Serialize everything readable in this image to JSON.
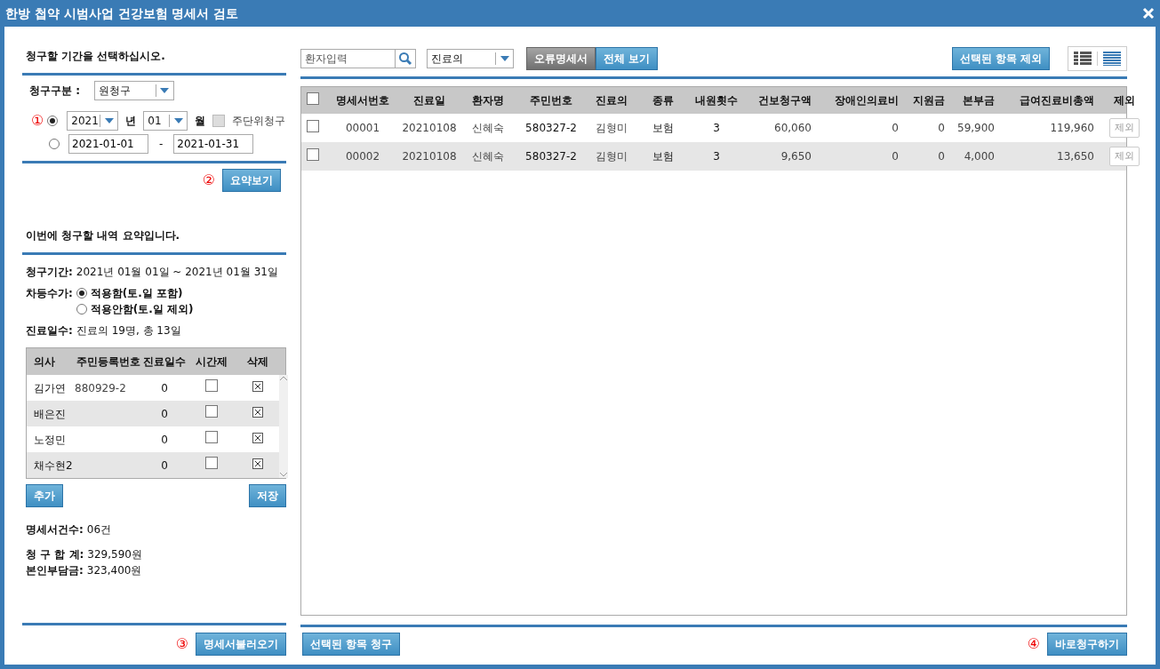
{
  "window": {
    "title": "한방 첩약 시범사업 건강보험 명세서 검토"
  },
  "period": {
    "heading": "청구할 기간을 선택하십시오.",
    "type_label": "청구구분 :",
    "type_value": "원청구",
    "options": [
      {
        "kind": "month",
        "selected": true,
        "marker": "①",
        "year": "2021",
        "year_unit": "년",
        "month": "01",
        "month_unit": "월",
        "weekly_label": "주단위청구",
        "weekly_checked": false
      },
      {
        "kind": "range",
        "selected": false,
        "from": "2021-01-01",
        "separator": "-",
        "to": "2021-01-31"
      }
    ],
    "summary_marker": "②",
    "summary_button": "요약보기"
  },
  "summary": {
    "heading": "이번에 청구할 내역 요약입니다.",
    "period_label": "청구기간:",
    "period_value": "2021년 01월 01일 ~ 2021년 01월 31일",
    "surcharge_label": "차등수가:",
    "surcharge_options": [
      {
        "label": "적용함(토.일 포함)",
        "selected": true
      },
      {
        "label": "적용안함(토.일 제외)",
        "selected": false
      }
    ],
    "days_label": "진료일수:",
    "days_value": "진료의 19명, 총 13일",
    "doctors": {
      "columns": [
        "의사",
        "주민등록번호",
        "진료일수",
        "시간제",
        "삭제"
      ],
      "rows": [
        {
          "name": "김가연",
          "rrn": "880929-2",
          "days": "0",
          "part_time": false
        },
        {
          "name": "배은진",
          "days": "0",
          "part_time": false
        },
        {
          "name": "노정민",
          "days": "0",
          "part_time": false
        },
        {
          "name": "채수현2",
          "days": "0",
          "part_time": false
        }
      ]
    },
    "add_button": "추가",
    "save_button": "저장",
    "stats": [
      {
        "label": "명세서건수:",
        "value": "06건"
      },
      {
        "label": "청 구 합 계:",
        "value": "329,590원"
      },
      {
        "label": "본인부담금:",
        "value": "323,400원"
      }
    ]
  },
  "load": {
    "marker": "③",
    "button": "명세서불러오기"
  },
  "toolbar": {
    "patient_placeholder": "환자입력",
    "doctor_select": "진료의",
    "filters": [
      {
        "label": "오류명세서",
        "kind": "dark"
      },
      {
        "label": "전체 보기",
        "kind": "blue"
      }
    ],
    "exclude_button": "선택된 항목 제외",
    "views": [
      {
        "kind": "detail",
        "selected": false
      },
      {
        "kind": "compact",
        "selected": true
      }
    ]
  },
  "table": {
    "select_all_checked": false,
    "columns": [
      "명세서번호",
      "진료일",
      "환자명",
      "주민번호",
      "진료의",
      "종류",
      "내원횟수",
      "건보청구액",
      "장애인의료비",
      "지원금",
      "본부금",
      "급여진료비총액",
      "제외"
    ],
    "rows": [
      {
        "checked": false,
        "cells": [
          "00001",
          "20210108",
          "신혜숙",
          "580327-2",
          "김형미",
          "보험",
          "3",
          "60,060",
          "0",
          "0",
          "59,900",
          "119,960"
        ],
        "exclude": "제외"
      },
      {
        "checked": false,
        "cells": [
          "00002",
          "20210108",
          "신혜숙",
          "580327-2",
          "김형미",
          "보험",
          "3",
          "9,650",
          "0",
          "0",
          "4,000",
          "13,650"
        ],
        "exclude": "제외"
      }
    ]
  },
  "footer": {
    "claim_button": "선택된 항목 청구",
    "marker": "④",
    "claim_now_button": "바로청구하기"
  }
}
